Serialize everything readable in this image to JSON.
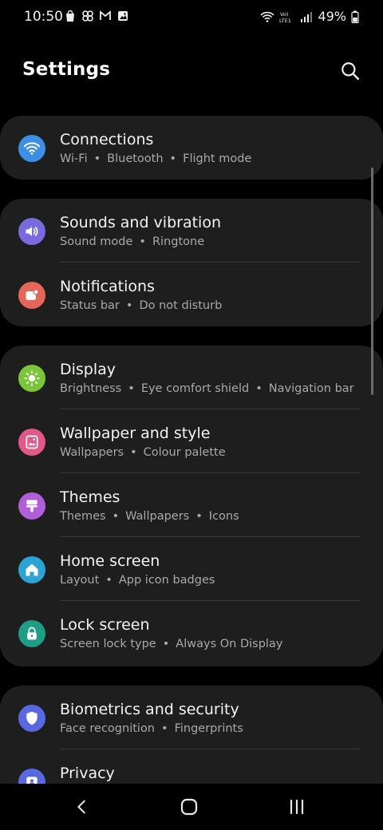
{
  "status_bar": {
    "time": "10:50",
    "battery_text": "49%",
    "left_icons": [
      "shopping-bag-icon",
      "pinwheel-icon",
      "gmail-icon",
      "gallery-icon"
    ],
    "right_icons": [
      "wifi-icon",
      "volte-icon",
      "signal-icon",
      "battery-icon"
    ]
  },
  "header": {
    "title": "Settings"
  },
  "groups": [
    {
      "items": [
        {
          "title": "Connections",
          "subtitle_parts": [
            "Wi-Fi",
            "Bluetooth",
            "Flight mode"
          ],
          "icon": "wifi-icon",
          "color": "#3d8ee6"
        }
      ]
    },
    {
      "items": [
        {
          "title": "Sounds and vibration",
          "subtitle_parts": [
            "Sound mode",
            "Ringtone"
          ],
          "icon": "volume-icon",
          "color": "#7a6ae0"
        },
        {
          "title": "Notifications",
          "subtitle_parts": [
            "Status bar",
            "Do not disturb"
          ],
          "icon": "notification-icon",
          "color": "#e4665a"
        }
      ]
    },
    {
      "items": [
        {
          "title": "Display",
          "subtitle_parts": [
            "Brightness",
            "Eye comfort shield",
            "Navigation bar"
          ],
          "icon": "brightness-icon",
          "color": "#7cc43a"
        },
        {
          "title": "Wallpaper and style",
          "subtitle_parts": [
            "Wallpapers",
            "Colour palette"
          ],
          "icon": "wallpaper-icon",
          "color": "#e0598a"
        },
        {
          "title": "Themes",
          "subtitle_parts": [
            "Themes",
            "Wallpapers",
            "Icons"
          ],
          "icon": "themes-icon",
          "color": "#b05fd8"
        },
        {
          "title": "Home screen",
          "subtitle_parts": [
            "Layout",
            "App icon badges"
          ],
          "icon": "home-icon",
          "color": "#2ba3d4"
        },
        {
          "title": "Lock screen",
          "subtitle_parts": [
            "Screen lock type",
            "Always On Display"
          ],
          "icon": "lock-icon",
          "color": "#1e9e86"
        }
      ]
    },
    {
      "items": [
        {
          "title": "Biometrics and security",
          "subtitle_parts": [
            "Face recognition",
            "Fingerprints"
          ],
          "icon": "shield-icon",
          "color": "#5868e0"
        },
        {
          "title": "Privacy",
          "subtitle_parts": [],
          "icon": "privacy-icon",
          "color": "#5868e0"
        }
      ]
    }
  ],
  "navbar": {
    "buttons": [
      "back-icon",
      "home-button-icon",
      "recents-icon"
    ]
  }
}
